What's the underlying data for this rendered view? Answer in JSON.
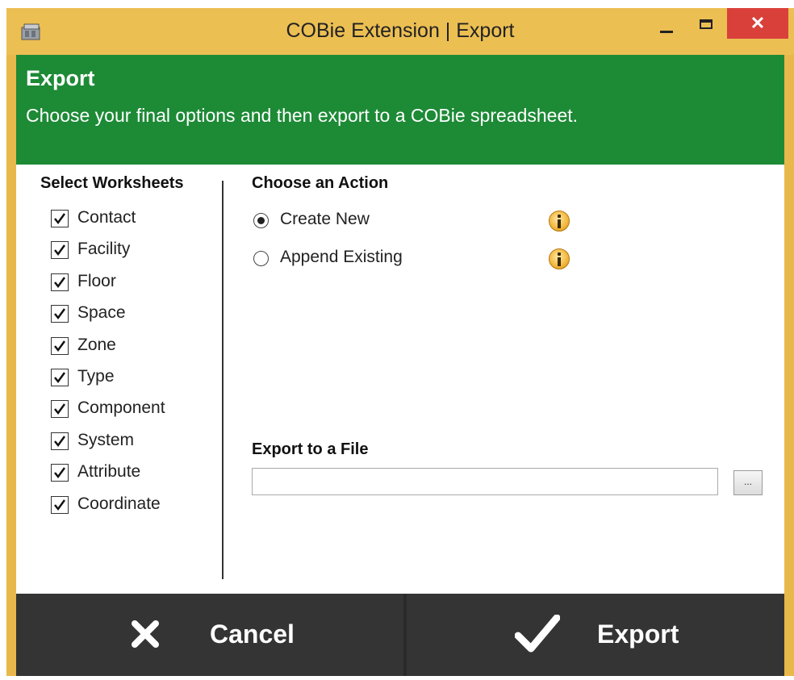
{
  "window": {
    "title": "COBie Extension | Export",
    "close_glyph": "✕"
  },
  "header": {
    "title": "Export",
    "subtitle": "Choose your final options and then export to a COBie spreadsheet."
  },
  "worksheets": {
    "title": "Select Worksheets",
    "items": [
      {
        "label": "Contact",
        "checked": true
      },
      {
        "label": "Facility",
        "checked": true
      },
      {
        "label": "Floor",
        "checked": true
      },
      {
        "label": "Space",
        "checked": true
      },
      {
        "label": "Zone",
        "checked": true
      },
      {
        "label": "Type",
        "checked": true
      },
      {
        "label": "Component",
        "checked": true
      },
      {
        "label": "System",
        "checked": true
      },
      {
        "label": "Attribute",
        "checked": true
      },
      {
        "label": "Coordinate",
        "checked": true
      }
    ]
  },
  "action": {
    "title": "Choose an Action",
    "options": [
      {
        "label": "Create New",
        "selected": true,
        "icon": "info-icon"
      },
      {
        "label": "Append Existing",
        "selected": false,
        "icon": "info-icon"
      }
    ]
  },
  "file": {
    "title": "Export to a File",
    "value": "",
    "browse_label": "..."
  },
  "footer": {
    "cancel_label": "Cancel",
    "export_label": "Export",
    "cancel_icon": "close-x-icon",
    "export_icon": "checkmark-icon"
  },
  "colors": {
    "titlebar": "#ecbf53",
    "header": "#1d8a36",
    "close": "#d9403a",
    "footer": "#343434"
  }
}
